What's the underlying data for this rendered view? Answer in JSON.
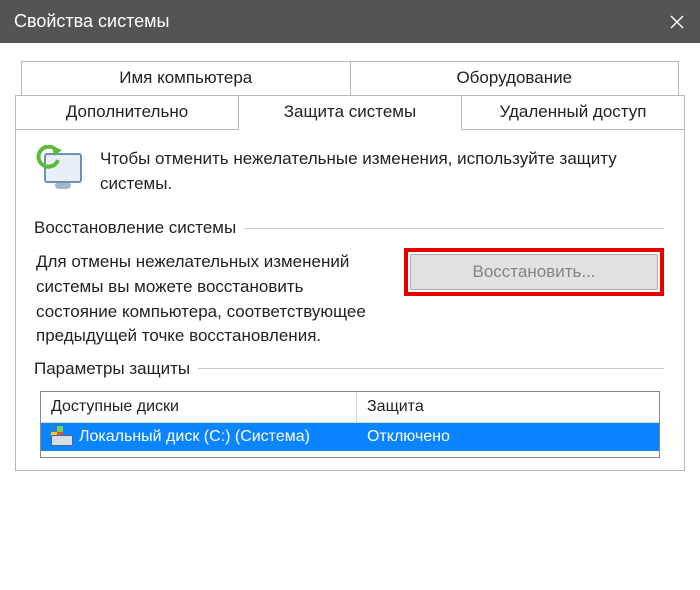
{
  "window": {
    "title": "Свойства системы"
  },
  "tabs": {
    "row1": [
      {
        "label": "Имя компьютера"
      },
      {
        "label": "Оборудование"
      }
    ],
    "row2": [
      {
        "label": "Дополнительно"
      },
      {
        "label": "Защита системы"
      },
      {
        "label": "Удаленный доступ"
      }
    ],
    "activeIndex": 1
  },
  "intro": {
    "text": "Чтобы отменить нежелательные изменения, используйте защиту системы."
  },
  "sections": {
    "restore": {
      "title": "Восстановление системы",
      "description": "Для отмены нежелательных изменений системы вы можете восстановить состояние компьютера, соответствующее предыдущей точке восстановления.",
      "button_label": "Восстановить..."
    },
    "protection": {
      "title": "Параметры защиты",
      "columns": {
        "drive": "Доступные диски",
        "protection": "Защита"
      },
      "rows": [
        {
          "name": "Локальный диск (C:) (Система)",
          "status": "Отключено"
        }
      ]
    }
  }
}
